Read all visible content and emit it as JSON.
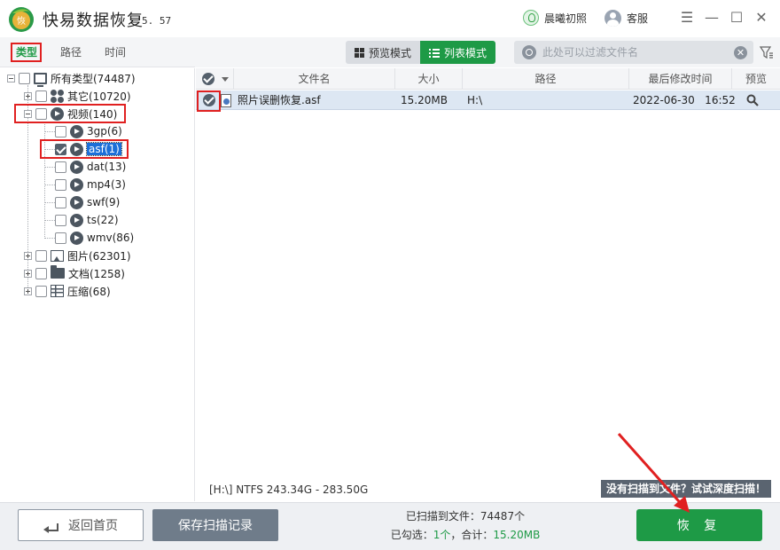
{
  "app": {
    "title": "快易数据恢复",
    "version": "5. 57",
    "logo_text": "恢",
    "user_name": "晨曦初照",
    "service_label": "客服"
  },
  "left_tabs": [
    "类型",
    "路径",
    "时间"
  ],
  "view_modes": {
    "preview": "预览模式",
    "list": "列表模式",
    "active": "list"
  },
  "search": {
    "placeholder": "此处可以过滤文件名",
    "value": ""
  },
  "tree": {
    "root": "所有类型(74487)",
    "other": "其它(10720)",
    "video": "视频(140)",
    "video_children": [
      "3gp(6)",
      "asf(1)",
      "dat(13)",
      "mp4(3)",
      "swf(9)",
      "ts(22)",
      "wmv(86)"
    ],
    "image": "图片(62301)",
    "doc": "文档(1258)",
    "zip": "压缩(68)",
    "selected": "asf(1)"
  },
  "table": {
    "columns": [
      "文件名",
      "大小",
      "路径",
      "最后修改时间",
      "预览"
    ],
    "rows": [
      {
        "name": "照片误删恢复.asf",
        "size": "15.20MB",
        "path": "H:\\",
        "modified": "2022-06-30   16:52",
        "checked": true
      }
    ]
  },
  "status": {
    "drive": "[H:\\] NTFS 243.34G - 283.50G",
    "deep_scan": "没有扫描到文件？试试深度扫描！"
  },
  "bottom": {
    "back_label": "返回首页",
    "save_label": "保存扫描记录",
    "scanned_prefix": "已扫描到文件：",
    "scanned_count": "74487个",
    "selected_prefix": "已勾选：",
    "selected_count": "1个",
    "total_prefix": "，合计：",
    "total_size": "15.20MB",
    "recover_label": "恢 复"
  },
  "colors": {
    "accent": "#1e9a46",
    "annotation": "#e02020",
    "selection": "#1c6fd8"
  }
}
